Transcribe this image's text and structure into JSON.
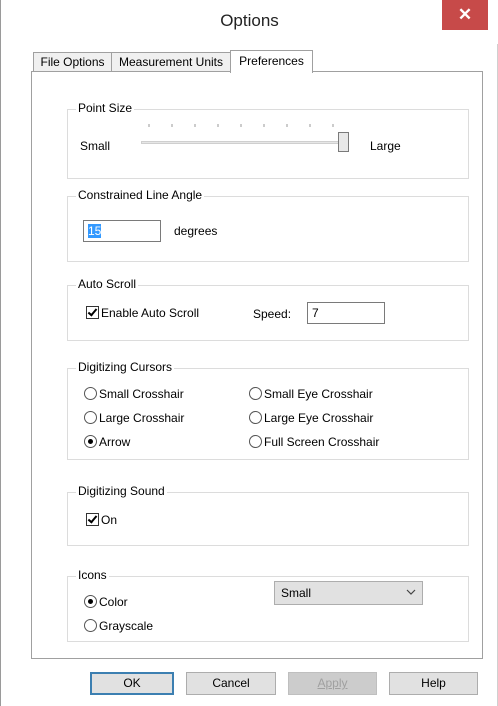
{
  "window": {
    "title": "Options",
    "close_glyph": "✕"
  },
  "tabs": [
    {
      "label": "File Options",
      "active": false
    },
    {
      "label": "Measurement Units",
      "active": false
    },
    {
      "label": "Preferences",
      "active": true
    }
  ],
  "point_size": {
    "group_label": "Point Size",
    "min_label": "Small",
    "max_label": "Large",
    "value_fraction": 1.0
  },
  "constrained_line_angle": {
    "group_label": "Constrained Line Angle",
    "value": "15",
    "unit_label": "degrees"
  },
  "auto_scroll": {
    "group_label": "Auto Scroll",
    "enable_label": "Enable Auto Scroll",
    "enabled": true,
    "speed_label": "Speed:",
    "speed_value": "7"
  },
  "digitizing_cursors": {
    "group_label": "Digitizing Cursors",
    "options": [
      {
        "label": "Small Crosshair",
        "selected": false
      },
      {
        "label": "Small Eye Crosshair",
        "selected": false
      },
      {
        "label": "Large Crosshair",
        "selected": false
      },
      {
        "label": "Large Eye Crosshair",
        "selected": false
      },
      {
        "label": "Arrow",
        "selected": true
      },
      {
        "label": "Full Screen Crosshair",
        "selected": false
      }
    ]
  },
  "digitizing_sound": {
    "group_label": "Digitizing Sound",
    "on_label": "On",
    "on": true
  },
  "icons": {
    "group_label": "Icons",
    "color_label": "Color",
    "grayscale_label": "Grayscale",
    "selected": "Color",
    "size_value": "Small"
  },
  "buttons": {
    "ok": "OK",
    "cancel": "Cancel",
    "apply": "Apply",
    "help": "Help"
  },
  "colors": {
    "close_button": "#c74a49",
    "selection_highlight": "#3399ff"
  }
}
